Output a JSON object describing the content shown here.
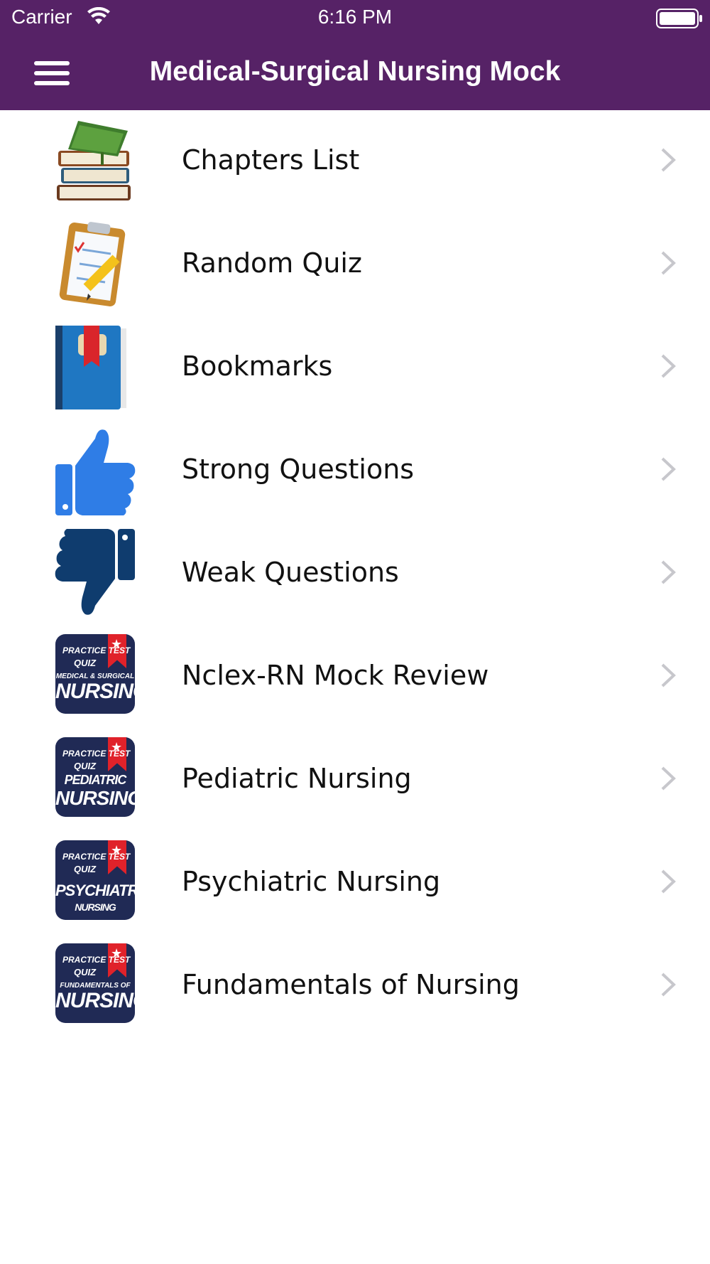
{
  "status": {
    "carrier": "Carrier",
    "time": "6:16 PM",
    "wifi_icon": "wifi-icon",
    "battery_icon": "battery-icon"
  },
  "navbar": {
    "title": "Medical-Surgical Nursing Mock",
    "menu_icon": "hamburger-menu-icon",
    "background": "#562266"
  },
  "menu": [
    {
      "label": "Chapters List",
      "icon": "books-icon"
    },
    {
      "label": "Random Quiz",
      "icon": "clipboard-pencil-icon"
    },
    {
      "label": "Bookmarks",
      "icon": "bookmark-book-icon"
    },
    {
      "label": "Strong Questions",
      "icon": "thumbs-up-icon"
    },
    {
      "label": "Weak Questions",
      "icon": "thumbs-down-icon"
    },
    {
      "label": "Nclex-RN Mock Review",
      "icon": "app-badge-medical-surgical-icon",
      "badge": {
        "line1": "PRACTICE TEST",
        "line2": "QUIZ",
        "line3": "MEDICAL & SURGICAL",
        "line4": "NURSING"
      }
    },
    {
      "label": "Pediatric Nursing",
      "icon": "app-badge-pediatric-icon",
      "badge": {
        "line1": "PRACTICE TEST",
        "line2": "QUIZ",
        "line3": "PEDIATRIC",
        "line4": "NURSING"
      }
    },
    {
      "label": "Psychiatric Nursing",
      "icon": "app-badge-psychiatric-icon",
      "badge": {
        "line1": "PRACTICE TEST",
        "line2": "QUIZ",
        "line3": "PSYCHIATRIC",
        "line4": "NURSING"
      }
    },
    {
      "label": "Fundamentals of Nursing",
      "icon": "app-badge-fundamentals-icon",
      "badge": {
        "line1": "PRACTICE TEST",
        "line2": "QUIZ",
        "line3": "FUNDAMENTALS OF",
        "line4": "NURSING"
      }
    }
  ],
  "chevron_icon": "chevron-right-icon"
}
